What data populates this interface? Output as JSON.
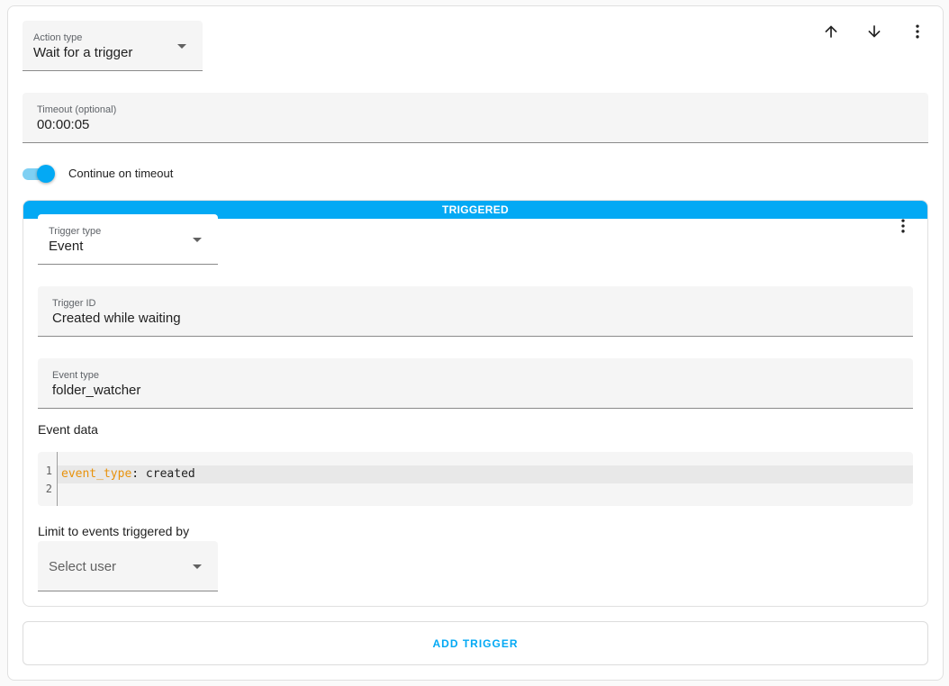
{
  "action": {
    "type_label": "Action type",
    "type_value": "Wait for a trigger"
  },
  "toolbar": {
    "move_up_icon": "arrow-up-icon",
    "move_down_icon": "arrow-down-icon",
    "menu_icon": "more-vert-icon"
  },
  "timeout": {
    "label": "Timeout (optional)",
    "value": "00:00:05"
  },
  "continue_on_timeout": {
    "label": "Continue on timeout",
    "enabled": true
  },
  "trigger": {
    "banner": "TRIGGERED",
    "type_label": "Trigger type",
    "type_value": "Event",
    "menu_icon": "more-vert-icon",
    "id_label": "Trigger ID",
    "id_value": "Created while waiting",
    "event_type_label": "Event type",
    "event_type_value": "folder_watcher",
    "event_data_label": "Event data",
    "code": {
      "lines": [
        {
          "number": "1",
          "key": "event_type",
          "sep": ":",
          "value": " created"
        },
        {
          "number": "2",
          "key": "",
          "sep": "",
          "value": ""
        }
      ]
    },
    "limit_label": "Limit to events triggered by",
    "user_placeholder": "Select user"
  },
  "add_trigger_label": "ADD TRIGGER",
  "colors": {
    "accent": "#03a9f4",
    "yaml_key": "#e8920c"
  }
}
